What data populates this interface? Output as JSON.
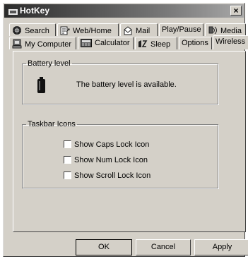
{
  "window": {
    "title": "HotKey",
    "close_glyph": "×"
  },
  "tabs": {
    "row1": [
      {
        "label": "Search",
        "icon": "search-icon"
      },
      {
        "label": "Web/Home",
        "icon": "webhome-icon"
      },
      {
        "label": "Mail",
        "icon": "mail-icon"
      },
      {
        "label": "Play/Pause",
        "icon": ""
      },
      {
        "label": "Media",
        "icon": "media-icon"
      }
    ],
    "row2": [
      {
        "label": "My Computer",
        "icon": "my-computer-icon"
      },
      {
        "label": "Calculator",
        "icon": "calculator-icon"
      },
      {
        "label": "Sleep",
        "icon": "sleep-icon"
      },
      {
        "label": "Options",
        "icon": ""
      },
      {
        "label": "Wireless",
        "icon": "",
        "active": true
      }
    ]
  },
  "battery": {
    "legend": "Battery level",
    "icon": "battery-icon",
    "message": "The battery level is available."
  },
  "taskbar": {
    "legend": "Taskbar Icons",
    "options": [
      {
        "label": "Show Caps Lock Icon",
        "checked": false
      },
      {
        "label": "Show Num Lock Icon",
        "checked": false
      },
      {
        "label": "Show Scroll Lock Icon",
        "checked": false
      }
    ]
  },
  "buttons": {
    "ok": "OK",
    "cancel": "Cancel",
    "apply": "Apply"
  }
}
